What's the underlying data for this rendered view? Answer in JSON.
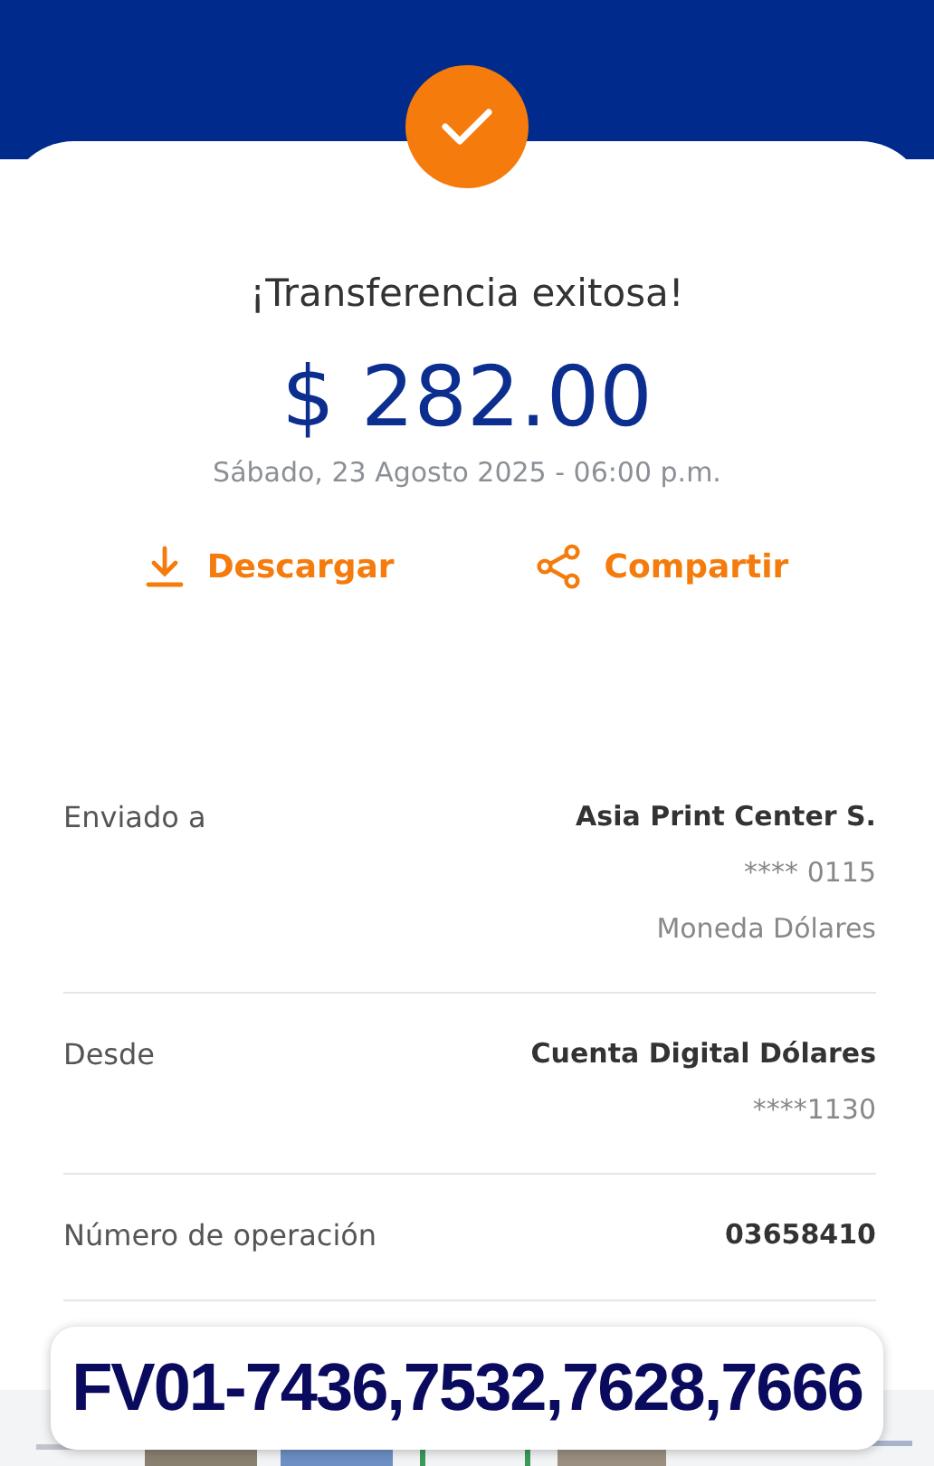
{
  "title": "¡Transferencia exitosa!",
  "amount": "$ 282.00",
  "date": "Sábado, 23 Agosto 2025 - 06:00 p.m.",
  "actions": [
    {
      "kind": "download",
      "label": "Descargar"
    },
    {
      "kind": "share",
      "label": "Compartir"
    }
  ],
  "details": [
    {
      "label": "Enviado a",
      "values": [
        "Asia Print Center S.",
        "**** 0115",
        "Moneda Dólares"
      ]
    },
    {
      "label": "Desde",
      "values": [
        "Cuenta Digital Dólares",
        "****1130"
      ]
    },
    {
      "label": "Número de operación",
      "values": [
        "03658410"
      ]
    }
  ],
  "overlay_label": "FV01-7436,7532,7628,7666"
}
